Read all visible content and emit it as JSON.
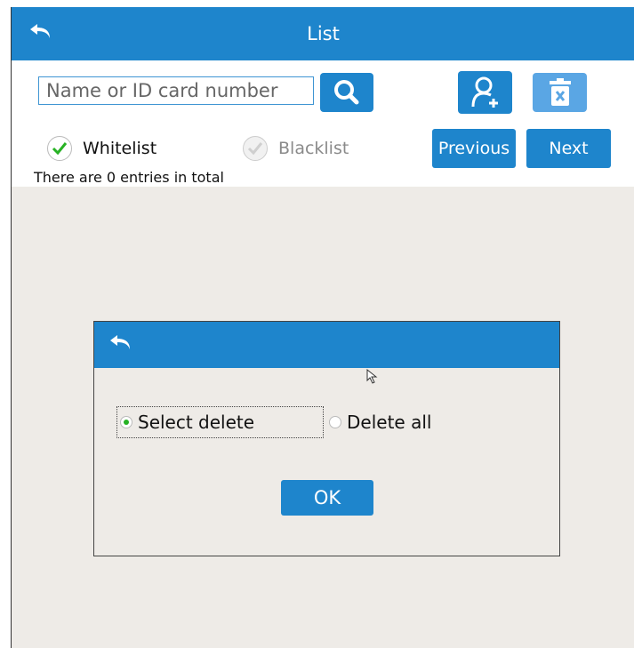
{
  "header": {
    "title": "List",
    "back_icon": "back-arrow-icon"
  },
  "search": {
    "placeholder": "Name or ID card number",
    "value": "",
    "search_icon": "search-icon"
  },
  "toolbar": {
    "add_user_icon": "add-user-icon",
    "delete_icon": "trash-icon"
  },
  "filters": {
    "whitelist": {
      "label": "Whitelist",
      "checked": true
    },
    "blacklist": {
      "label": "Blacklist",
      "checked": true,
      "disabled": true
    }
  },
  "pagination": {
    "previous_label": "Previous",
    "next_label": "Next"
  },
  "summary": {
    "count_text": "There are 0 entries in total"
  },
  "dialog": {
    "back_icon": "back-arrow-icon",
    "options": [
      {
        "label": "Select delete",
        "selected": true
      },
      {
        "label": "Delete all",
        "selected": false
      }
    ],
    "ok_label": "OK"
  },
  "colors": {
    "primary": "#1e85cc",
    "primary_light": "#5aa6e4",
    "check_green": "#27b224",
    "background": "#eeebe7"
  }
}
